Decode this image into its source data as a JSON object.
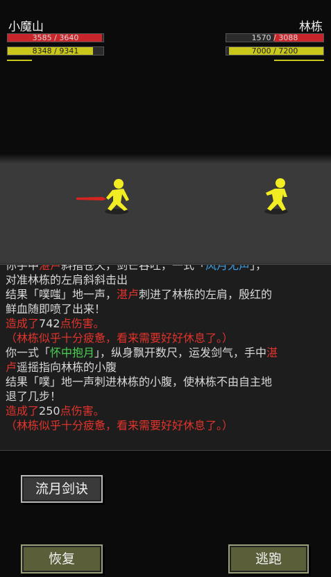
{
  "player": {
    "name": "小魔山",
    "hp_text": "3585 / 3640",
    "hp_fraction": 0.985,
    "mp_text": "8348 / 9341",
    "mp_fraction": 0.894,
    "hp_color": "#c8262b",
    "mp_color": "#c9c71b"
  },
  "enemy": {
    "name": "林栋",
    "hp_text": "1570 / 3088",
    "hp_fraction": 0.508,
    "mp_text": "7000 / 7200",
    "mp_fraction": 0.972
  },
  "battle_log": {
    "lines": [
      [
        {
          "t": "你手中"
        },
        {
          "t": "湛卢",
          "c": "red"
        },
        {
          "t": "斜指苍天，剑芒吞吐，一式「"
        },
        {
          "t": "风月无声",
          "c": "blue"
        },
        {
          "t": "」，"
        }
      ],
      [
        {
          "t": "对准林栋的左肩斜斜击出"
        }
      ],
      [
        {
          "t": "结果「噗嗤」地一声，"
        },
        {
          "t": "湛卢",
          "c": "red"
        },
        {
          "t": "刺进了林栋的左肩，殷红的"
        }
      ],
      [
        {
          "t": "鲜血随即喷了出来！"
        }
      ],
      [
        {
          "t": "造成了",
          "c": "red"
        },
        {
          "t": "742"
        },
        {
          "t": "点伤害。",
          "c": "red"
        }
      ],
      [
        {
          "t": "（林栋似乎十分疲惫，看来需要好好休息了。）",
          "c": "red"
        }
      ],
      [
        {
          "t": "你一式「"
        },
        {
          "t": "怀中抱月",
          "c": "green"
        },
        {
          "t": "」，纵身飘开数尺，运发剑气，手中"
        },
        {
          "t": "湛",
          "c": "red"
        }
      ],
      [
        {
          "t": "卢",
          "c": "red"
        },
        {
          "t": "遥摇指向林栋的小腹"
        }
      ],
      [
        {
          "t": "结果「噗」地一声刺进林栋的小腹，使林栋不由自主地"
        }
      ],
      [
        {
          "t": "退了几步！"
        }
      ],
      [
        {
          "t": "造成了",
          "c": "red"
        },
        {
          "t": "250"
        },
        {
          "t": "点伤害。",
          "c": "red"
        }
      ],
      [
        {
          "t": "（林栋似乎十分疲惫，看来需要好好休息了。）",
          "c": "red"
        }
      ]
    ]
  },
  "actions": {
    "skill_label": "流月剑诀",
    "recover_label": "恢复",
    "flee_label": "逃跑"
  }
}
